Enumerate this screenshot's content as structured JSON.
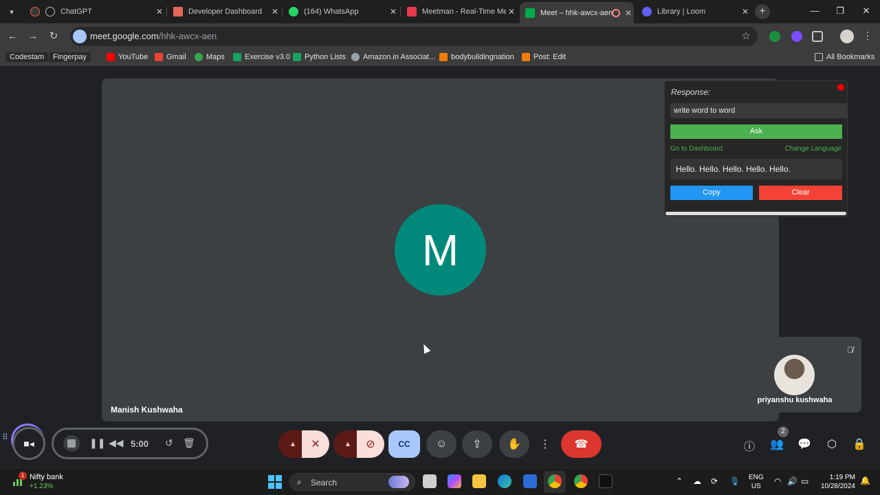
{
  "browser": {
    "tabs": [
      {
        "title": "ChatGPT",
        "favicon": "chatgpt-icon",
        "color": "#ffffff"
      },
      {
        "title": "Developer Dashboard",
        "favicon": "dashboard-icon",
        "color": "#e6655a"
      },
      {
        "title": "(164) WhatsApp",
        "favicon": "whatsapp-icon",
        "color": "#25d366"
      },
      {
        "title": "Meetman - Real-Time Me",
        "favicon": "meetman-icon",
        "color": "#e53950"
      },
      {
        "title": "Meet – hhk-awcx-aen",
        "favicon": "meet-icon",
        "color": "#00ac47",
        "active": true
      },
      {
        "title": "Library | Loom",
        "favicon": "loom-icon",
        "color": "#625df5"
      }
    ],
    "url_host": "meet.google.com",
    "url_path": "/hhk-awcx-aen",
    "bookmarks": [
      {
        "label": "Codestam",
        "chip": true,
        "color": ""
      },
      {
        "label": "Fingerpay",
        "chip": true,
        "color": ""
      },
      {
        "label": "YouTube",
        "color": "#ff0000"
      },
      {
        "label": "Gmail",
        "color": "#ea4335"
      },
      {
        "label": "Maps",
        "color": "#34a853"
      },
      {
        "label": "Exercise v3.0",
        "color": "#1aa260"
      },
      {
        "label": "Python Lists",
        "color": "#1aa260"
      },
      {
        "label": "Amazon.in Associat...",
        "color": "#9aa0a6"
      },
      {
        "label": "bodybuildingnation",
        "color": "#f57d00"
      },
      {
        "label": "Post: Edit",
        "color": "#f57d00"
      }
    ],
    "all_bookmarks": "All Bookmarks"
  },
  "meet": {
    "main_initial": "M",
    "main_name": "Manish Kushwaha",
    "self_name": "priyanshu kushwaha",
    "people_count": "2"
  },
  "panel": {
    "title": "Response:",
    "input_value": "write word to word",
    "ask": "Ask",
    "go_dashboard": "Go to Dashboard",
    "change_language": "Change Language",
    "response_text": "Hello. Hello. Hello. Hello. Hello.",
    "copy": "Copy",
    "clear": "Clear"
  },
  "loom": {
    "timer": "5:00"
  },
  "taskbar": {
    "stock_name": "Nifty bank",
    "stock_change": "+1.23%",
    "stock_badge": "1",
    "search": "Search",
    "lang_line1": "ENG",
    "lang_line2": "US",
    "time": "1:19 PM",
    "date": "10/28/2024"
  }
}
